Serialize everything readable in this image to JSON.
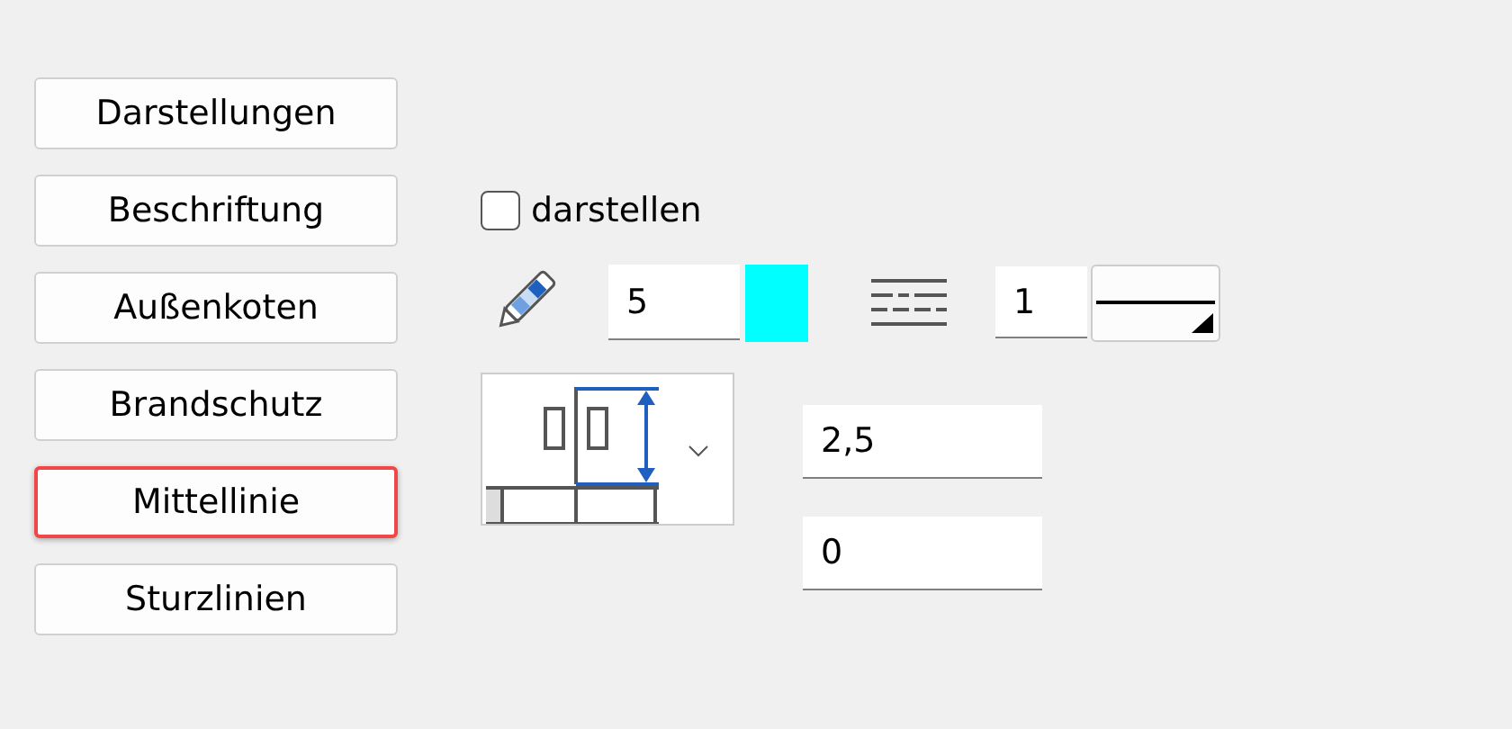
{
  "nav_buttons": [
    {
      "label": "Darstellungen",
      "selected": false
    },
    {
      "label": "Beschriftung",
      "selected": false
    },
    {
      "label": "Außenkoten",
      "selected": false
    },
    {
      "label": "Brandschutz",
      "selected": false
    },
    {
      "label": "Mittellinie",
      "selected": true
    },
    {
      "label": "Sturzlinien",
      "selected": false
    }
  ],
  "show_checkbox": {
    "label": "darstellen",
    "checked": false
  },
  "pen_field": {
    "value": "5"
  },
  "color_swatch": {
    "color": "#00ffff"
  },
  "line_type_field": {
    "value": "1"
  },
  "value_fields": [
    {
      "value": "2,5"
    },
    {
      "value": "0"
    }
  ]
}
